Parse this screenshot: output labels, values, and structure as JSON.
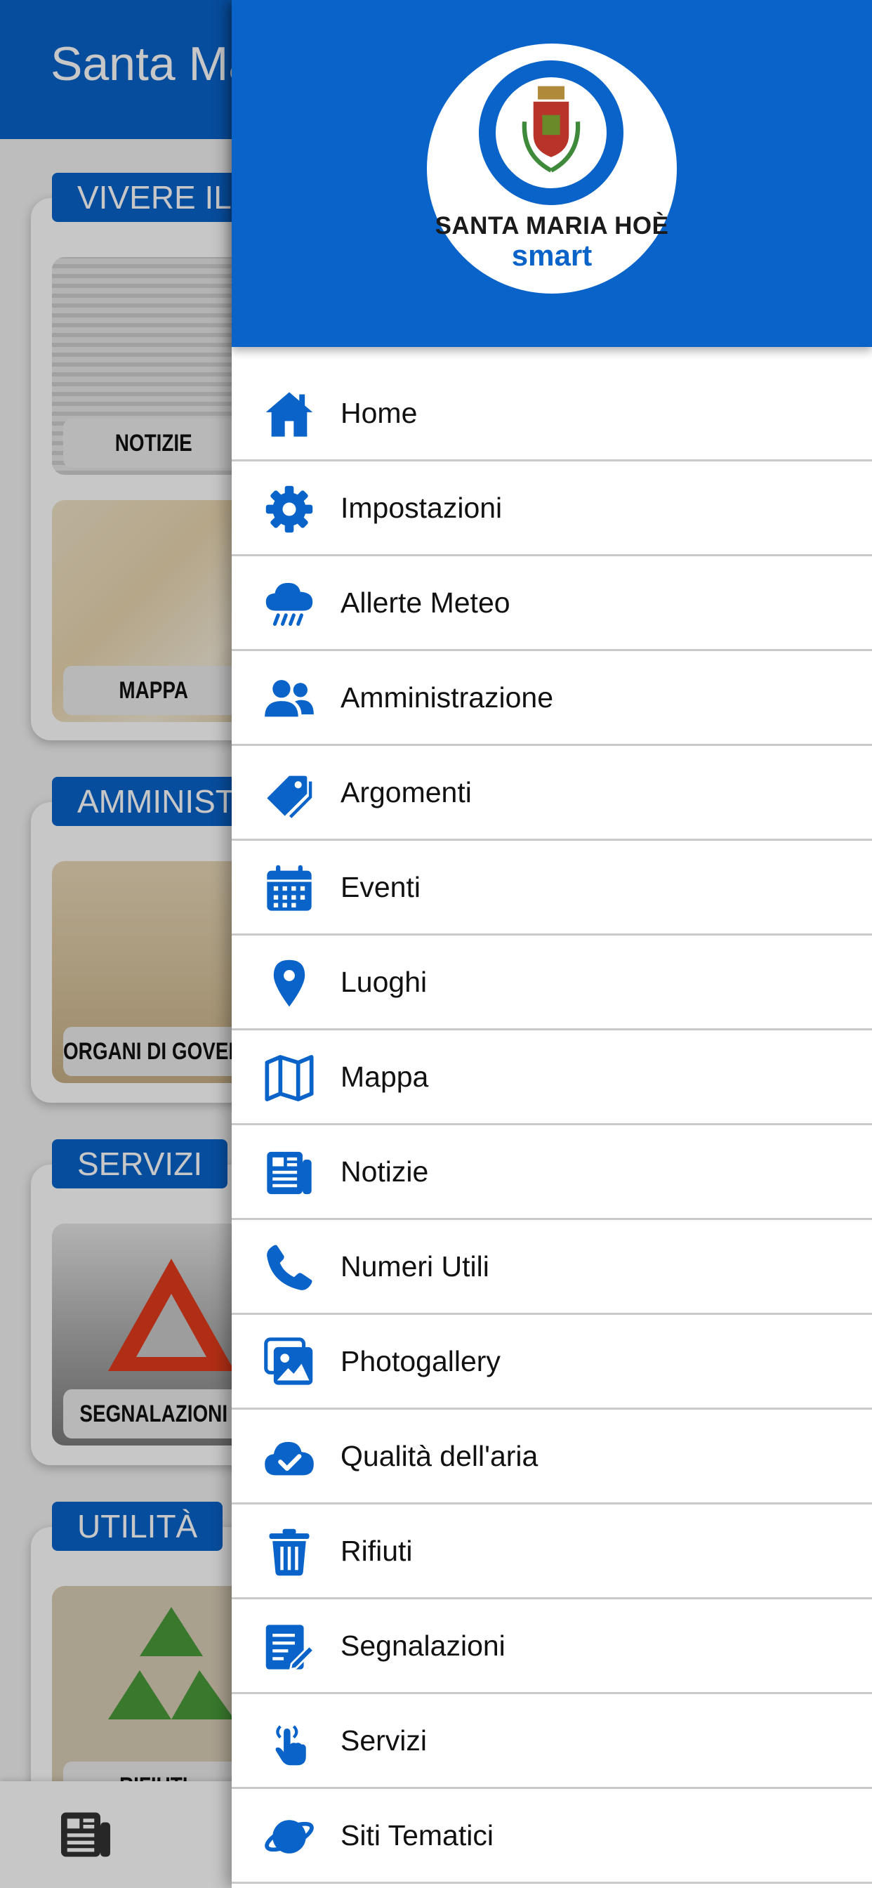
{
  "app": {
    "title": "Santa Maria Hoè",
    "sections": [
      {
        "title": "VIVERE IL",
        "tiles": [
          "NOTIZIE",
          "MAPPA"
        ]
      },
      {
        "title": "AMMINISTRAZIONE",
        "tiles": [
          "ORGANI DI GOVERNO"
        ]
      },
      {
        "title": "SERVIZI",
        "tiles": [
          "SEGNALAZIONI"
        ]
      },
      {
        "title": "UTILITÀ",
        "tiles": [
          "RIFIUTI"
        ]
      }
    ],
    "bottom_bar": {
      "icon": "news-icon"
    }
  },
  "drawer": {
    "logo": {
      "name": "SANTA MARIA HOÈ",
      "sub": "smart"
    },
    "colors": {
      "primary": "#0a63c9"
    },
    "menu": [
      {
        "label": "Home",
        "icon": "home-icon"
      },
      {
        "label": "Impostazioni",
        "icon": "gear-icon"
      },
      {
        "label": "Allerte Meteo",
        "icon": "rain-cloud-icon"
      },
      {
        "label": "Amministrazione",
        "icon": "users-icon"
      },
      {
        "label": "Argomenti",
        "icon": "tag-icon"
      },
      {
        "label": "Eventi",
        "icon": "calendar-icon"
      },
      {
        "label": "Luoghi",
        "icon": "map-pin-icon"
      },
      {
        "label": "Mappa",
        "icon": "map-icon"
      },
      {
        "label": "Notizie",
        "icon": "newspaper-icon"
      },
      {
        "label": "Numeri Utili",
        "icon": "phone-icon"
      },
      {
        "label": "Photogallery",
        "icon": "images-icon"
      },
      {
        "label": "Qualità dell'aria",
        "icon": "cloud-check-icon"
      },
      {
        "label": "Rifiuti",
        "icon": "trash-icon"
      },
      {
        "label": "Segnalazioni",
        "icon": "report-edit-icon"
      },
      {
        "label": "Servizi",
        "icon": "hand-pointer-icon"
      },
      {
        "label": "Siti Tematici",
        "icon": "planet-icon"
      }
    ]
  }
}
